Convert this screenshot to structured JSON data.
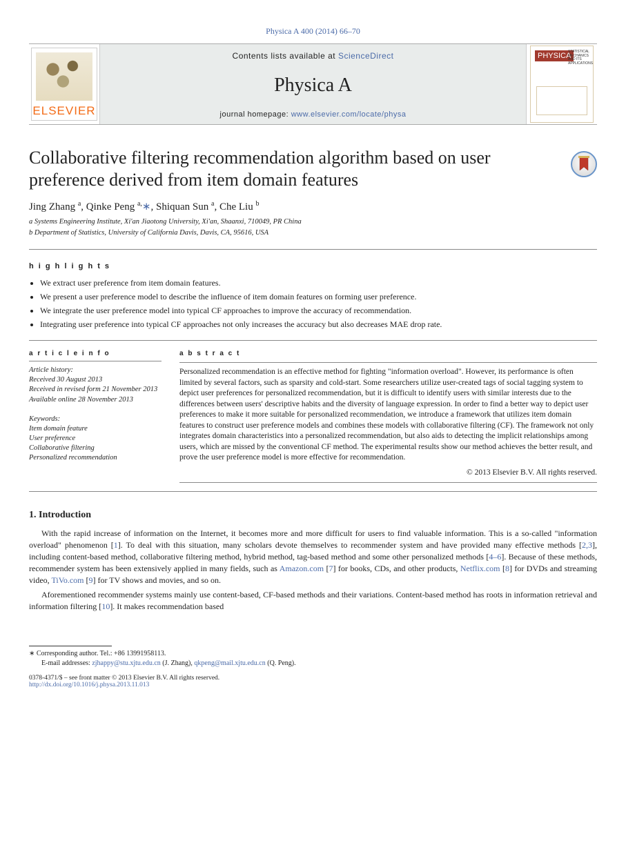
{
  "citation": "Physica A 400 (2014) 66–70",
  "banner": {
    "contents_prefix": "Contents lists available at ",
    "sciencedirect": "ScienceDirect",
    "journal_name": "Physica A",
    "homepage_prefix": "journal homepage: ",
    "homepage_url": "www.elsevier.com/locate/physa",
    "elsevier": "ELSEVIER",
    "cover_sub": "STATISTICAL MECHANICS AND ITS APPLICATIONS"
  },
  "title": "Collaborative filtering recommendation algorithm based on user preference derived from item domain features",
  "authors_html": "Jing Zhang <sup>a</sup>, Qinke Peng <sup>a,</sup><a class='corr-link' href='#'>∗</a>, Shiquan Sun <sup>a</sup>, Che Liu <sup>b</sup>",
  "affiliations": [
    "a Systems Engineering Institute, Xi'an Jiaotong University, Xi'an, Shaanxi, 710049, PR China",
    "b Department of Statistics, University of California Davis, Davis, CA, 95616, USA"
  ],
  "highlights_title": "h i g h l i g h t s",
  "highlights": [
    "We extract user preference from item domain features.",
    "We present a user preference model to describe the influence of item domain features on forming user preference.",
    "We integrate the user preference model into typical CF approaches to improve the accuracy of recommendation.",
    "Integrating user preference into typical CF approaches not only increases the accuracy but also decreases MAE drop rate."
  ],
  "article_info_title": "a r t i c l e  i n f o",
  "history": [
    "Article history:",
    "Received 30 August 2013",
    "Received in revised form 21 November 2013",
    "Available online 28 November 2013"
  ],
  "keywords_title": "Keywords:",
  "keywords": [
    "Item domain feature",
    "User preference",
    "Collaborative filtering",
    "Personalized recommendation"
  ],
  "abstract_title": "a b s t r a c t",
  "abstract_body": "Personalized recommendation is an effective method for fighting \"information overload\". However, its performance is often limited by several factors, such as sparsity and cold-start. Some researchers utilize user-created tags of social tagging system to depict user preferences for personalized recommendation, but it is difficult to identify users with similar interests due to the differences between users' descriptive habits and the diversity of language expression. In order to find a better way to depict user preferences to make it more suitable for personalized recommendation, we introduce a framework that utilizes item domain features to construct user preference models and combines these models with collaborative filtering (CF). The framework not only integrates domain characteristics into a personalized recommendation, but also aids to detecting the implicit relationships among users, which are missed by the conventional CF method. The experimental results show our method achieves the better result, and prove the user preference model is more effective for recommendation.",
  "copyright": "© 2013 Elsevier B.V. All rights reserved.",
  "section_num": "1.",
  "section_title": "Introduction",
  "intro_body_pre": "With the rapid increase of information on the Internet, it becomes more and more difficult for users to find valuable information. This is a so-called \"information overload\" phenomenon [",
  "ref1": "1",
  "intro_body_mid1": "]. To deal with this situation, many scholars devote themselves to recommender system and have provided many effective methods [",
  "ref23": "2,3",
  "intro_body_mid2": "], including content-based method, collaborative filtering method, hybrid method, tag-based method and some other personalized methods [",
  "ref46": "4–6",
  "intro_body_mid3": "]. Because of these methods, recommender system has been extensively applied in many fields, such as ",
  "amazon": "Amazon.com",
  "ref7_open": " [",
  "ref7": "7",
  "ref7_close": "] for books, CDs, and other products, ",
  "netflix": "Netflix.com",
  "ref8_open": " [",
  "ref8": "8",
  "ref8_close": "] for DVDs and streaming video, ",
  "tivo": "TiVo.com",
  "ref9_open": " [",
  "ref9": "9",
  "intro_body_mid4": "] for TV shows and movies, and so on.",
  "intro_p2_pre": "Aforementioned recommender systems mainly use content-based, CF-based methods and their variations. Content-based method has roots in information retrieval and information filtering [",
  "ref10": "10",
  "intro_p2_post": "]. It makes recommendation based",
  "footnote_corr_label": "∗ ",
  "footnote_corr_text": "Corresponding author. Tel.: +86 13991958113.",
  "footnote_email_label": "E-mail addresses: ",
  "email1": "zjhappy@stu.xjtu.edu.cn",
  "email1_suffix": " (J. Zhang), ",
  "email2": "qkpeng@mail.xjtu.edu.cn",
  "email2_suffix": " (Q. Peng).",
  "doi_line_prefix": "0378-4371/$ – see front matter © 2013 Elsevier B.V. All rights reserved.",
  "doi_url": "http://dx.doi.org/10.1016/j.physa.2013.11.013"
}
